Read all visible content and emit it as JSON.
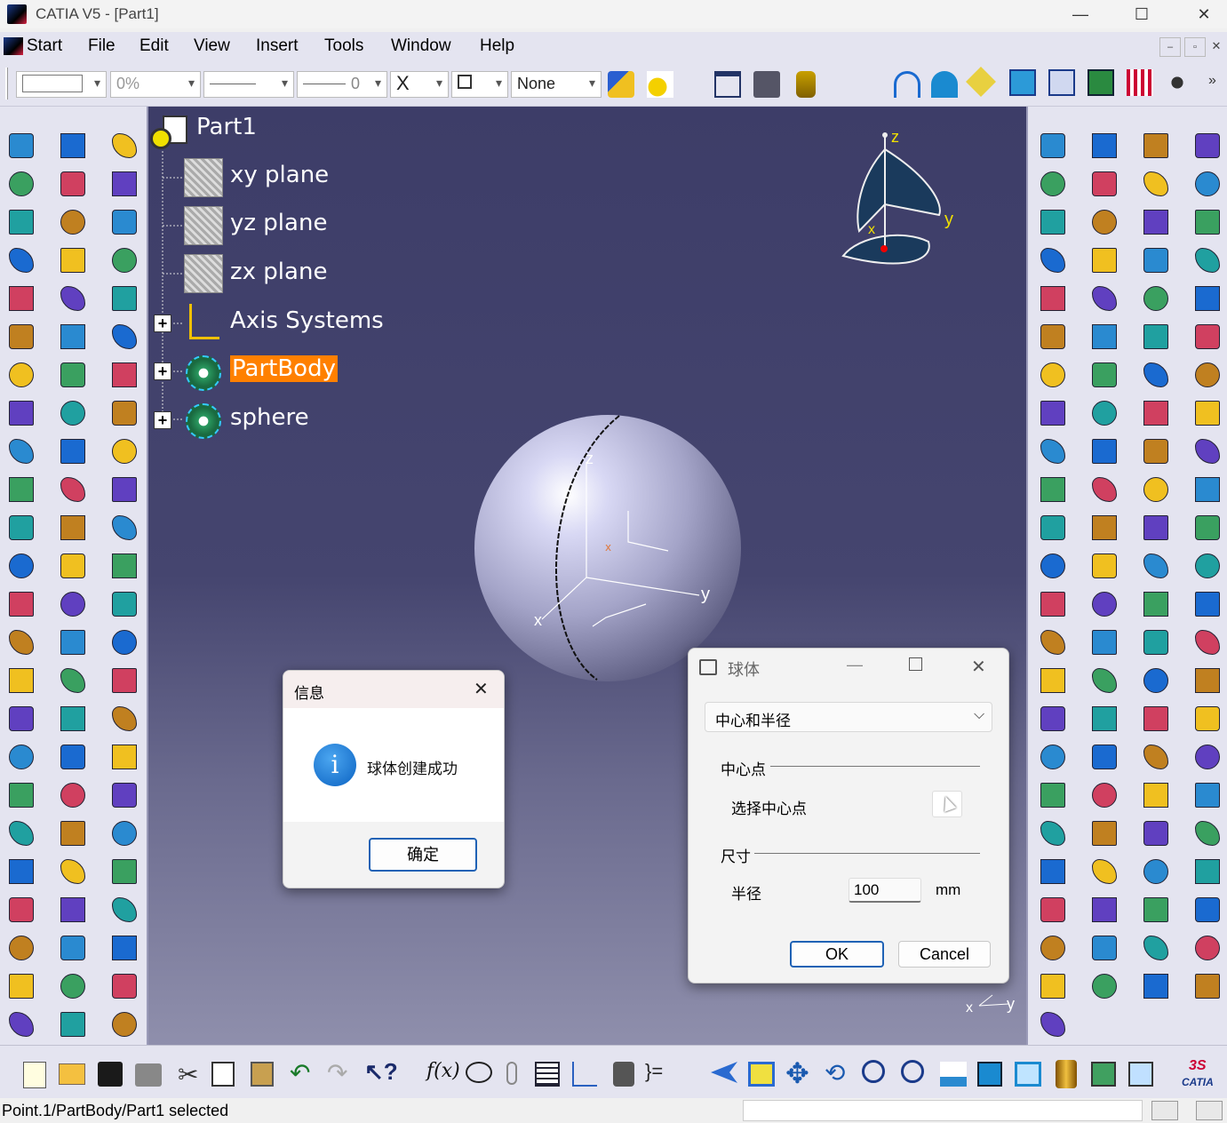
{
  "window": {
    "title": "CATIA V5 - [Part1]",
    "minimize": "—",
    "maximize": "☐",
    "close": "✕"
  },
  "menu": {
    "start": "Start",
    "file": "File",
    "edit": "Edit",
    "view": "View",
    "insert": "Insert",
    "tools": "Tools",
    "window": "Window",
    "help": "Help"
  },
  "toolbar": {
    "transparency": "0%",
    "thickness": "0",
    "point_symbol": "X",
    "layer": "None"
  },
  "tree": {
    "root": "Part1",
    "items": [
      "xy plane",
      "yz plane",
      "zx plane",
      "Axis Systems",
      "PartBody",
      "sphere"
    ]
  },
  "compass": {
    "z": "z",
    "y": "y",
    "x": "x"
  },
  "sphere_axes": {
    "z": "z",
    "y": "y",
    "x": "x"
  },
  "corner_axes": {
    "x": "x",
    "y": "y"
  },
  "info_dialog": {
    "title": "信息",
    "message": "球体创建成功",
    "icon": "i",
    "ok": "确定"
  },
  "sphere_dialog": {
    "title": "球体",
    "mode": "中心和半径",
    "center_section": "中心点",
    "select_center": "选择中心点",
    "size_section": "尺寸",
    "radius_label": "半径",
    "radius_value": "100",
    "unit": "mm",
    "ok": "OK",
    "cancel": "Cancel"
  },
  "status": {
    "text": "Point.1/PartBody/Part1 selected"
  },
  "brand": "CATIA",
  "colors": {
    "viewport": "#45456f",
    "highlight": "#ff8000",
    "dialog_accent": "#1f62b5"
  }
}
